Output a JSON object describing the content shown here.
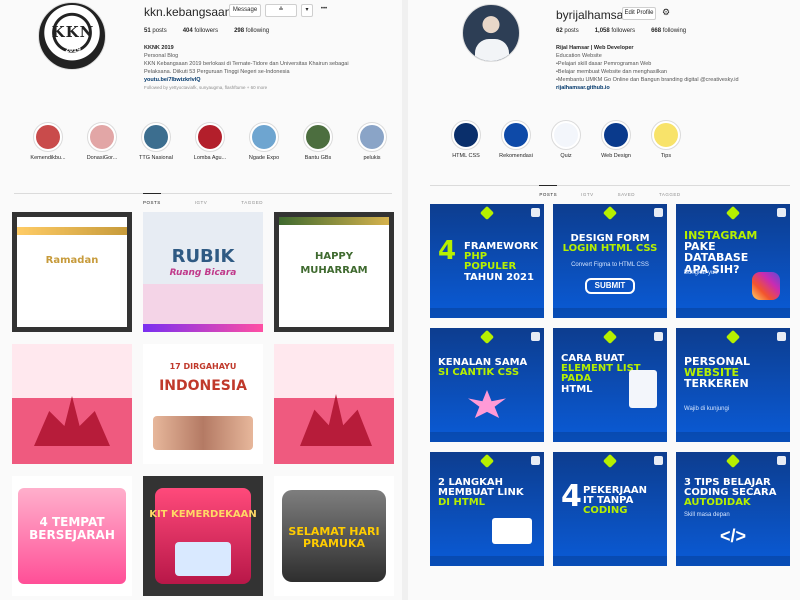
{
  "left": {
    "username": "kkn.kebangsaan",
    "buttons": {
      "message": "Message",
      "follow": "≗",
      "dropdown": "▾",
      "more": "•••"
    },
    "stats": {
      "posts": "51",
      "posts_label": "posts",
      "followers": "404",
      "followers_label": "followers",
      "following": "298",
      "following_label": "following"
    },
    "bio": {
      "name": "KKNK 2019",
      "category": "Personal Blog",
      "line1": "KKN Kebangsaan 2019 berlokasi di Ternate-Tidore dan Universitas Khairun sebagai",
      "line2": "Pelaksana. Diikuti 53 Perguruan Tinggi Negeri se-Indonesia",
      "link": "youtu.be/7lbwizkrlvlQ",
      "followed_by": "Followed by yettyoctaviafk, sunyaugma, flashftume + 60 more"
    },
    "avatar": {
      "text": "KKN",
      "year": "2019"
    },
    "highlights": [
      {
        "label": "Kemendikbu...",
        "color": "#c94b4b"
      },
      {
        "label": "DonasiGor...",
        "color": "#e2a6a6"
      },
      {
        "label": "TTG Nasional",
        "color": "#3c6e8f"
      },
      {
        "label": "Lomba Agu...",
        "color": "#b31f2b"
      },
      {
        "label": "Ngade Expo",
        "color": "#6ea5d0"
      },
      {
        "label": "Bantu GBs",
        "color": "#4c6e3f"
      },
      {
        "label": "pelukis",
        "color": "#8aa4c7"
      }
    ],
    "tabs": [
      "POSTS",
      "IGTV",
      "TAGGED"
    ],
    "tiles": [
      {
        "title": "",
        "sub": "Ramadan"
      },
      {
        "title": "RUBIK",
        "sub": "Ruang Bicara"
      },
      {
        "title": "HAPPY",
        "sub": "MUHARRAM"
      },
      {
        "title": "",
        "sub": ""
      },
      {
        "title": "INDONESIA",
        "sub": "17 DIRGAHAYU"
      },
      {
        "title": "",
        "sub": ""
      },
      {
        "title": "4 TEMPAT BERSEJARAH",
        "sub": ""
      },
      {
        "title": "KIT KEMERDEKAAN",
        "sub": ""
      },
      {
        "title": "SELAMAT HARI PRAMUKA",
        "sub": ""
      }
    ]
  },
  "right": {
    "username": "byrijalhamsar",
    "buttons": {
      "edit": "Edit Profile",
      "settings": "⚙"
    },
    "stats": {
      "posts": "62",
      "posts_label": "posts",
      "followers": "1,058",
      "followers_label": "followers",
      "following": "668",
      "following_label": "following"
    },
    "bio": {
      "name": "Rijal Hamsar | Web Developer",
      "category": "Education Website",
      "line1": "•Pelajari skill dasar Pemrograman Web",
      "line2": "•Belajar membuat Website dan menghasilkan",
      "line3": "•Membantu UMKM Go Online dan Bangun branding digital @creativesky.id",
      "link": "rijalhamsar.github.io"
    },
    "highlights": [
      {
        "label": "HTML CSS",
        "color": "#0a2f6b"
      },
      {
        "label": "Rekomendasi",
        "color": "#0e4aa8"
      },
      {
        "label": "Quiz",
        "color": "#f3f6fb"
      },
      {
        "label": "Web Design",
        "color": "#0a3a8c"
      },
      {
        "label": "Tips",
        "color": "#f8e36a"
      }
    ],
    "tabs": [
      "POSTS",
      "IGTV",
      "SAVED",
      "TAGGED"
    ],
    "tiles": [
      {
        "big": "4",
        "t1": "FRAMEWORK",
        "t2": "PHP POPULER",
        "t3": "TAHUN 2021",
        "sub": ""
      },
      {
        "big": "",
        "t1": "DESIGN FORM",
        "t2": "LOGIN HTML CSS",
        "t3": "SUBMIT",
        "sub": "Convert Figma to HTML CSS"
      },
      {
        "big": "",
        "t1": "INSTAGRAM",
        "t2": "PAKE DATABASE",
        "t3": "APA SIH?",
        "sub": "Bongkar yuk"
      },
      {
        "big": "",
        "t1": "KENALAN SAMA",
        "t2": "SI CANTIK CSS",
        "t3": "",
        "sub": ""
      },
      {
        "big": "",
        "t1": "CARA BUAT",
        "t2": "ELEMENT LIST PADA",
        "t3": "HTML",
        "sub": ""
      },
      {
        "big": "",
        "t1": "PERSONAL",
        "t2": "WEBSITE",
        "t3": "TERKEREN",
        "sub": "Wajib di kunjungi"
      },
      {
        "big": "",
        "t1": "2 LANGKAH",
        "t2": "MEMBUAT LINK",
        "t3": "DI HTML",
        "sub": ""
      },
      {
        "big": "4",
        "t1": "PEKERJAAN",
        "t2": "IT TANPA",
        "t3": "CODING",
        "sub": ""
      },
      {
        "big": "",
        "t1": "3 TIPS BELAJAR",
        "t2": "CODING SECARA",
        "t3": "AUTODIDAK",
        "sub": "Skill masa depan"
      }
    ]
  }
}
